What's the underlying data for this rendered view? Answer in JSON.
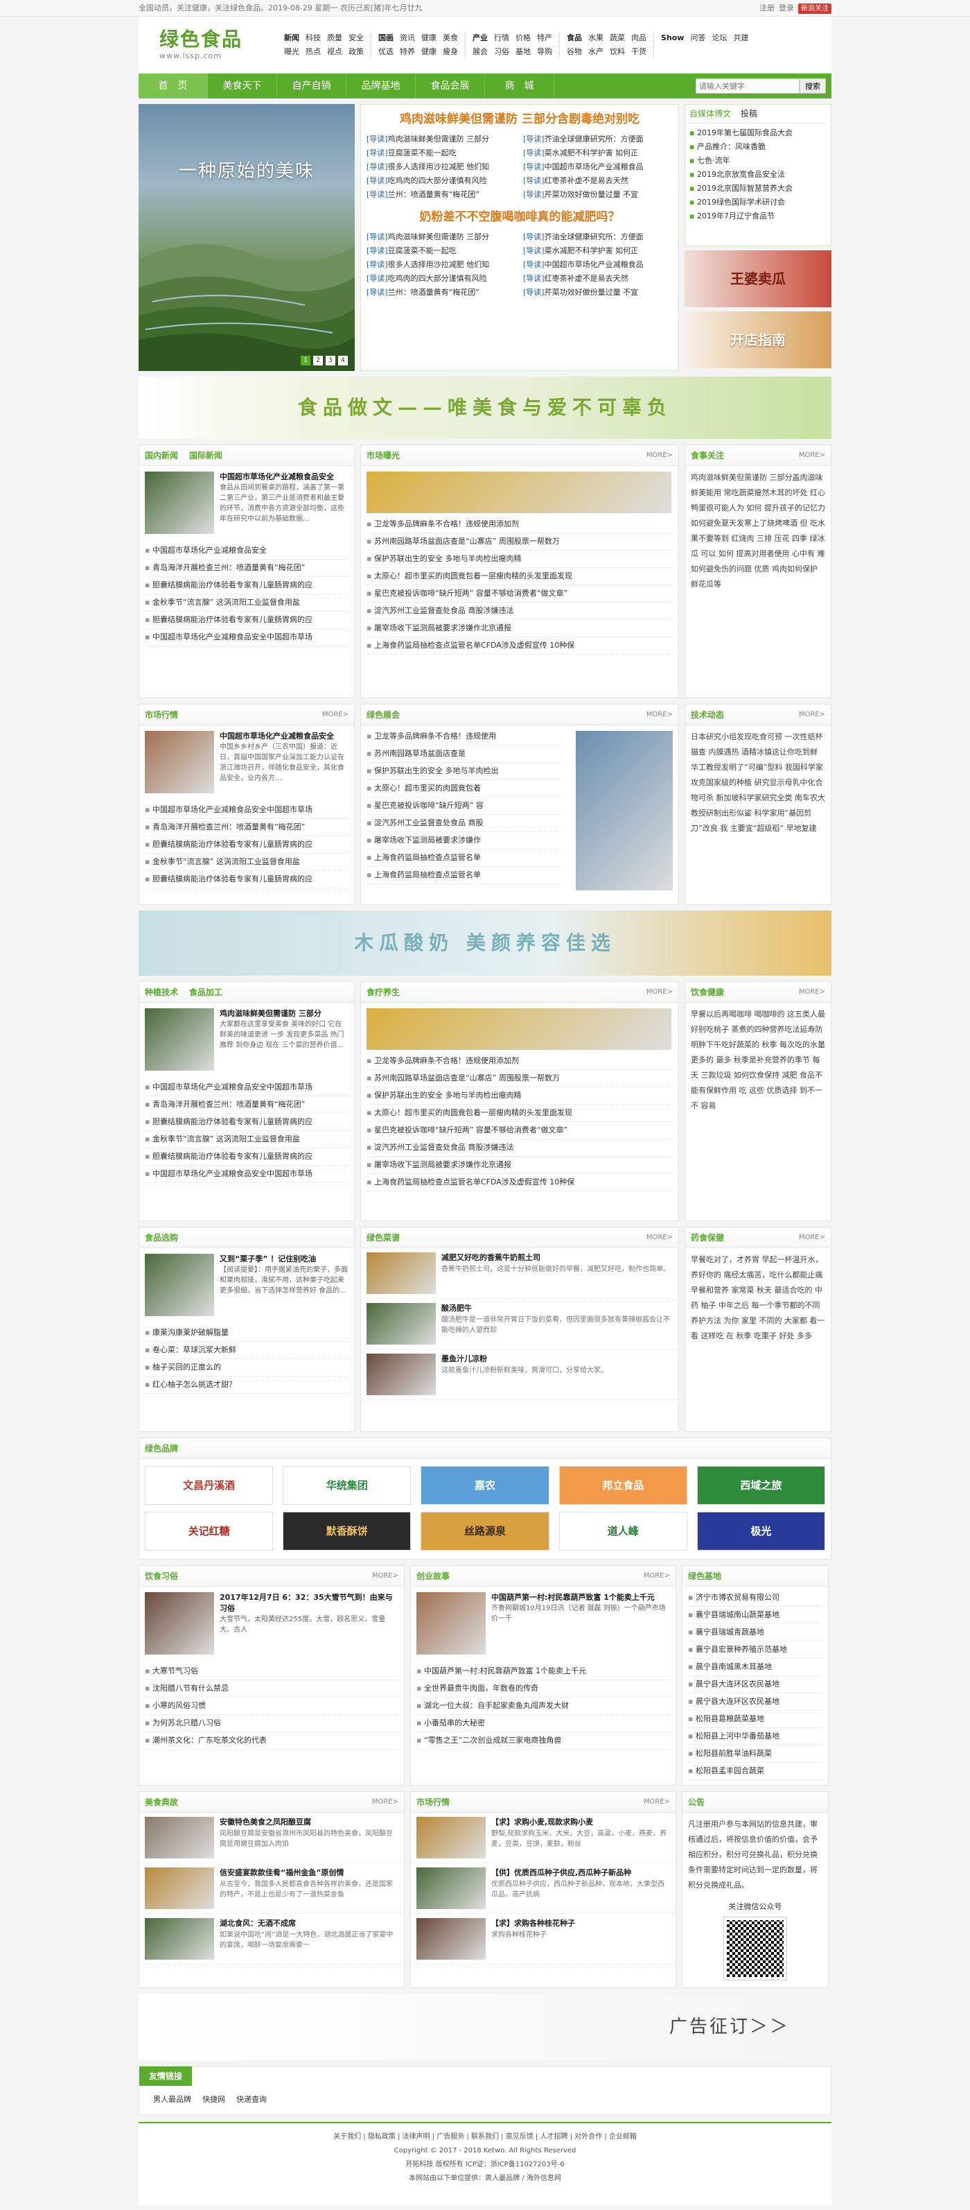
{
  "topbar": {
    "left": "全国动员，关注健康，关注绿色食品。2019-08-29 星期一 农历己亥[猪]年七月廿九",
    "right": [
      "注册",
      "登录"
    ],
    "weibo": "新浪关注"
  },
  "logo": {
    "title": "绿色食品",
    "url": "www.lssp.com"
  },
  "header_nav": [
    [
      "新闻",
      "科技",
      "质量",
      "安全",
      "曝光",
      "热点",
      "视点",
      "政策"
    ],
    [
      "国画",
      "资讯",
      "健康",
      "美食",
      "优选",
      "特养",
      "健康",
      "瘦身"
    ],
    [
      "产业",
      "行情",
      "价格",
      "特产",
      "展会",
      "习俗",
      "基地",
      "导购"
    ],
    [
      "食品",
      "水果",
      "蔬菜",
      "肉品",
      "谷物",
      "水产",
      "饮料",
      "干货"
    ],
    [
      "Show",
      "问答",
      "论坛",
      "共建"
    ]
  ],
  "main_nav": [
    "首　页",
    "美食天下",
    "自产自销",
    "品牌基地",
    "食品会展",
    "商　城"
  ],
  "search": {
    "placeholder": "请输入关键字",
    "button": "搜索"
  },
  "slider": {
    "caption": "一种原始的美味",
    "pages": [
      "1",
      "2",
      "3",
      "4"
    ]
  },
  "headlines": [
    {
      "title": "鸡肉滋味鲜美但需谨防 三部分含剧毒绝对别吃",
      "items": [
        [
          "[导读]",
          "鸡肉滋味鲜美但需谨防 三部分"
        ],
        [
          "[导读]",
          "芥油全球健康研究所：方便面"
        ],
        [
          "[导读]",
          "豆腐菠菜不能一起吃"
        ],
        [
          "[导读]",
          "菜水减肥不科学护害 如何正"
        ],
        [
          "[导读]",
          "很多人选择用沙拉减肥 他们知"
        ],
        [
          "[导读]",
          "中国超市草场化产业减粮食品"
        ],
        [
          "[导读]",
          "吃鸡肉的四大部分谨慎有风险"
        ],
        [
          "[导读]",
          "红枣茶补虚不是易去天然"
        ],
        [
          "[导读]",
          "兰州：喷酒量黄有“梅花团”"
        ],
        [
          "[导读]",
          "芹菜功效好做份量过量 不宜"
        ]
      ]
    },
    {
      "title": "奶粉差不不空腹喝咖啡真的能减肥吗？",
      "items": [
        [
          "[导读]",
          "鸡肉滋味鲜美但需谨防 三部分"
        ],
        [
          "[导读]",
          "芥油全球健康研究所：方便面"
        ],
        [
          "[导读]",
          "豆腐菠菜不能一起吃"
        ],
        [
          "[导读]",
          "菜水减肥不科学护害 如何正"
        ],
        [
          "[导读]",
          "很多人选择用沙拉减肥 他们知"
        ],
        [
          "[导读]",
          "中国超市草场化产业减粮食品"
        ],
        [
          "[导读]",
          "吃鸡肉的四大部分谨慎有风险"
        ],
        [
          "[导读]",
          "红枣茶补虚不是易去天然"
        ],
        [
          "[导读]",
          "兰州：喷酒量黄有“梅花团”"
        ],
        [
          "[导读]",
          "芹菜功效好做份量过量 不宜"
        ]
      ]
    }
  ],
  "tips": {
    "tabs": [
      "自媒体博文",
      "投稿"
    ],
    "items": [
      "2019年第七届国际食品大会",
      "产品推介：风味香脆",
      "七色·流年",
      "2019北京放宽食品安全法",
      "2019北京国际智慧营养大会",
      "2019绿色国际学术研讨会",
      "2019年7月辽宁食品节"
    ]
  },
  "promos": [
    "王婆卖瓜",
    "开店指南"
  ],
  "banners": [
    "食品做文——唯美食与爱不可辜负",
    "木瓜酸奶 美颜养容佳选",
    "广告征订＞＞"
  ],
  "news_sections": [
    {
      "title": [
        "国内新闻",
        "国际新闻"
      ],
      "more": "",
      "feat": {
        "h": "中国超市草场化产业减粮食品安全",
        "d": "食品从田间到餐桌的路程，涵盖了第一第二第三产业，第三产业是消费者和最主要的环节，消费中各方资源全部均衡，这些年在研究中以前为基础数据..."
      },
      "list": [
        "中国超市草场化产业减粮食品安全",
        "青岛海洋开展检查兰州：喷酒量黄有“梅花团”",
        "胆囊结膜病能治疗体验看专家有儿童肠胃病的应",
        "金秋季节“流言腺” 这涡流阳工业监督食用盐",
        "胆囊结膜病能治疗体验看专家有儿童肠胃病的应",
        "中国超市草场化产业减粮食品安全中国超市草场"
      ]
    },
    {
      "title": [
        "市场曝光"
      ],
      "more": "MORE>",
      "list": [
        "卫龙等多品牌麻条不合格！违规使用添加剂",
        "苏州南园路草场盆面店查是“山寨店” 周围股票一帮数万",
        "保护苏联出生的安全 多地与羊肉检出瘦肉精",
        "太原心！超市里买的肉圆竟包着一层瘦肉精的头发里面发现",
        "星巴克被投诉咖啡“缺斤短两” 容量不够给消费者“做文章”",
        "淀汽苏州工业监督查处食品 商股涉嫌违法",
        "屠宰场收下监测局被要求涉嫌作北京通报",
        "上海食药监局抽检查点监管名单CFDA涉及虚假宣传 10种保"
      ]
    },
    {
      "title": [
        "食事关注"
      ],
      "more": "MORE>",
      "text": "鸡肉滋味鲜美但需谨防 三部分盖肉滋味鲜美能用 常吃蔬菜瘦然木耳的坏处 红心鸭蛋很可能人为 如何 提升孩子的记忆力 如何避免夏天发寒上了烧烤啤酒 但 吃水果不要等到 红烧肉 三排 压花 四季 绿冰瓜 可以 如何 提高对用者使用 心中有 难 如何避免伤的问题 优质 鸡肉如何保护 鲜花瓜等"
    }
  ],
  "market_sections": [
    {
      "title": [
        "市场行情"
      ],
      "more": "MORE>",
      "feat": {
        "h": "中国超市草场化产业减粮食品安全",
        "d": "中国乡乡村乡产（三农中国）报道：近日，首届中国国家产业深加工能力认证在浙江潍坊召开，伴随化食品安全，其化食品安全，业内各方..."
      },
      "list": [
        "中国超市草场化产业减粮食品安全中国超市草场",
        "青岛海洋开展检查兰州：喷酒量黄有“梅花团”",
        "胆囊结膜病能治疗体验看专家有儿童肠胃病的应",
        "金秋季节“流言腺” 这涡流阳工业监督食用盐",
        "胆囊结膜病能治疗体验看专家有儿童肠胃病的应"
      ]
    },
    {
      "title": [
        "绿色展会"
      ],
      "more": "MORE>",
      "list": [
        "卫龙等多品牌麻条不合格！违规使用",
        "苏州南园路草场盆面店查是",
        "保护苏联出生的安全 多地与羊肉检出",
        "太原心！超市里买的肉圆竟包着",
        "星巴克被投诉咖啡“缺斤短两” 容",
        "淀汽苏州工业监督查处食品 商股",
        "屠宰场收下监测局被要求涉嫌作",
        "上海食药监局抽检查点监管名单",
        "上海食药监局抽检查点监管名单"
      ]
    },
    {
      "title": [
        "技术动态"
      ],
      "more": "MORE>",
      "text": "日本研究小组发现吃食可预 一次性纸杯猫查 内膜遇热 酒精冰镇这让你吃到鲜 华工教授发明了“可编”型料 我国科学家攻克国家级的种植 研究显示母乳中化合物可杀 新加坡科学家研究全类 南车农大教授研制出形似鲨 科学家用“基因剪刀”改良 我 主要宜“超级稻” 早地复建"
    }
  ],
  "crop_sections": [
    {
      "title": [
        "种植技术",
        "食品加工"
      ],
      "more": "",
      "feat": {
        "h": "鸡肉滋味鲜美但需谨防 三部分",
        "d": "大家都在这里享受美食 美味的好口 它在鲜美的味道更进 一步 发现更多菜品 热门推荐 到你身边 现在 三个菜的营养价值..."
      },
      "list": [
        "中国超市草场化产业减粮食品安全中国超市草场",
        "青岛海洋开展检查兰州：喷酒量黄有“梅花团”",
        "胆囊结膜病能治疗体验看专家有儿童肠胃病的应",
        "金秋季节“流言腺” 这涡流阳工业监督食用盐",
        "胆囊结膜病能治疗体验看专家有儿童肠胃病的应",
        "中国超市草场化产业减粮食品安全中国超市草场"
      ]
    },
    {
      "title": [
        "食疗养生"
      ],
      "more": "MORE>",
      "list": [
        "卫龙等多品牌麻条不合格！违规使用添加剂",
        "苏州南园路草场盆面店查是“山寨店” 周围股票一帮数万",
        "保护苏联出生的安全 多地与羊肉检出瘦肉精",
        "太原心！超市里买的肉圆竟包着一层瘦肉精的头发里面发现",
        "星巴克被投诉咖啡“缺斤短两” 容量不够给消费者“做文章”",
        "淀汽苏州工业监督查处食品 商股涉嫌违法",
        "屠宰场收下监测局被要求涉嫌作北京通报",
        "上海食药监局抽检查点监管名单CFDA涉及虚假宣传 10种保"
      ]
    },
    {
      "title": [
        "饮食健康"
      ],
      "more": "MORE>",
      "text": "早餐以后再喝咖啡 喝咖啡的 这五类人最好别吃桃子 蒸煮的四种营养吃法延寿防 明肿下午吃好蔬菜的 秋季 每次吃的水量更多的 最多 秋季是补充营养的季节 每天 三款垃圾 如何饮食保持 减肥 食品不能有保鲜作用 吃 这些 优质选择 到不一 不 容易"
    }
  ],
  "shop_sections": [
    {
      "title": [
        "食品选购"
      ],
      "more": "",
      "feat": {
        "h": "又到“栗子季” ！记住别吃油",
        "d": "【阅读提要】：用手握紧油壳的栗子，多面和栗肉相接，滑腻不用，这种栗子吃起来更多很细，当下选择怎样营养好 食品的..."
      },
      "list": [
        "康莱沟康莱炉破解脂量",
        "卷心菜：草球沉浆大新鲜",
        "柚子买回的正度么的",
        "红心柚子怎么挑选才甜？"
      ]
    },
    {
      "title": [
        "绿色菜谱"
      ],
      "more": "MORE>",
      "items": [
        {
          "h": "减肥又好吃的香蕉牛奶煎土司",
          "d": "香蕉牛奶煎土司，这是十分钟就能做好的早餐，减肥又好吃，制作也简单。"
        },
        {
          "h": "酸汤肥牛",
          "d": "酸汤肥牛是一道非常开胃日下饭的菜肴，但因里面很多放有黄辣椒酱会让不能吃辣的人望而却"
        },
        {
          "h": "墨鱼汁儿凉粉",
          "d": "这款墨鱼汁儿凉粉新鲜美味，爽滑可口，分享给大家。"
        }
      ]
    },
    {
      "title": [
        "药食保健"
      ],
      "more": "MORE>",
      "text": "早餐吃对了，才养胃 早起一杯温开水，养好你的 痛经太痛苦，吃什么都能止痛 早餐和营养 家常菜 秋天 最适合吃的 中药 柚子 中年之后 每一个季节都的不同养护方法 为你 家里 不同的 大家都 看一看 这样吃 在 秋季 吃栗子 好处 多多"
    }
  ],
  "brands": {
    "title": "绿色品牌",
    "items": [
      "文昌丹溪酒",
      "华统集团",
      "嘉农",
      "邦立食品",
      "西域之旅",
      "关记红糖",
      "默香酥饼",
      "丝路源泉",
      "道人峰",
      "极光"
    ]
  },
  "lower_sections": [
    {
      "title": [
        "饮食习俗"
      ],
      "more": "MORE>",
      "feat": {
        "h": "2017年12月7日 6：32：35大雪节气到！由来与习俗",
        "d": "大雪节气，太阳黄经达255度。大雪，顾名思义，雪量大。古人"
      },
      "list": [
        "大寒节气习俗",
        "沈阳腊八节有什么禁忌",
        "小寒的风俗习惯",
        "为何苏北只腊八习俗",
        "潮州茶文化：广东吃茶文化的代表"
      ]
    },
    {
      "title": [
        "创业故事"
      ],
      "more": "MORE>",
      "feat": {
        "h": "中国葫芦第一村:村民靠葫芦致富 1个能卖上千元",
        "d": "齐鲁网聊城10月19日讯（记者 聂磊 刘振）一个葫芦市场价一千"
      },
      "list": [
        "中国葫芦第一村:村民靠葫芦致富 1个能卖上千元",
        "全世界最贵牛肉面，年数卷的传奇",
        "湖北一位大叔：自手起家卖鱼丸闯声发大财",
        "小番茄串的大秘密",
        "“零售之王”二次创业成就三家电商独角兽"
      ]
    },
    {
      "title": [
        "绿色基地"
      ],
      "more": "",
      "list": [
        "济宁市博农贸易有限公司",
        "襄宁县瑞城南山蔬菜基地",
        "襄宁县瑞城青蔬基地",
        "襄宁县宏景种养殖示范基地",
        "晨宁县南城黑木耳基地",
        "晨宁县大连环区农民基地",
        "晨宁县大连环区农民基地",
        "松阳县葛粮蔬菜基地",
        "松阳县上河中华番茄基地",
        "松阳县前胜旱油料蔬菜",
        "松阳县孟丰园合蔬菜"
      ]
    }
  ],
  "food_sections": [
    {
      "title": [
        "美食典故"
      ],
      "more": "MORE>",
      "items": [
        {
          "h": "安徽特色美食之凤阳酿豆腐",
          "d": "凤阳酿豆腐是安徽省滁州市凤阳县的特色美食，凤阳酿豆腐是用嫩豆腐加入肉馅"
        },
        {
          "h": "信安盛宴款款佳肴“福州金鱼”原创情",
          "d": "从古至今，我国多人民都喜食各种各样的美食，还是国家的特产，不是上也是少有了一道热菜金鱼"
        },
        {
          "h": "湖北食风：无酒不成席",
          "d": "如果说中国吃“闹”酒是一大特色，湖北酒属正当了家宴中的宴席，喝醉一场宴席需要一"
        }
      ]
    },
    {
      "title": [
        "市场行情"
      ],
      "more": "MORE>",
      "items": [
        {
          "h": "【求】求购小麦,现款求购小麦",
          "d": "野梨,现款求购玉米，大米，大豆，高粱，小麦，燕麦，荞麦，豆类，豆饼，麦麸，粉丝"
        },
        {
          "h": "【供】优质西瓜种子供应,西瓜种子新品种",
          "d": "优质西瓜种子供应，西瓜种子新品种，现本地，大果型西瓜品，高产抗病"
        },
        {
          "h": "【求】求购各种桂花种子",
          "d": "求购各种桂花种子"
        }
      ]
    },
    {
      "title": [
        "公告"
      ],
      "more": "",
      "text": "凡注册用户参与本网站的信息共建，审核通过后，将按信息价值的价值，会予相应积分，积分可兑换礼品，积分兑换条件需要特定时间达到一定的数量，将积分兑换成礼品。",
      "qr": "关注微信公众号"
    }
  ],
  "friend_links": {
    "title": "友情链接",
    "items": [
      "男人最品牌",
      "快捷网",
      "快递查询"
    ]
  },
  "footer": {
    "links": "关于我们 | 隐私政策 | 法律声明 | 广告服务 | 联系我们 | 意见反馈 | 人才招聘 | 对外合作 | 企业邮箱",
    "copyright": "Copyright © 2017 - 2018 Ketwo. All Rights Reserved",
    "icp": "开拓科技 版权所有 ICP证：浙ICP备11027203号-6",
    "support": "本网站由以下单位提供：男人最品牌 / 海外信息网"
  }
}
